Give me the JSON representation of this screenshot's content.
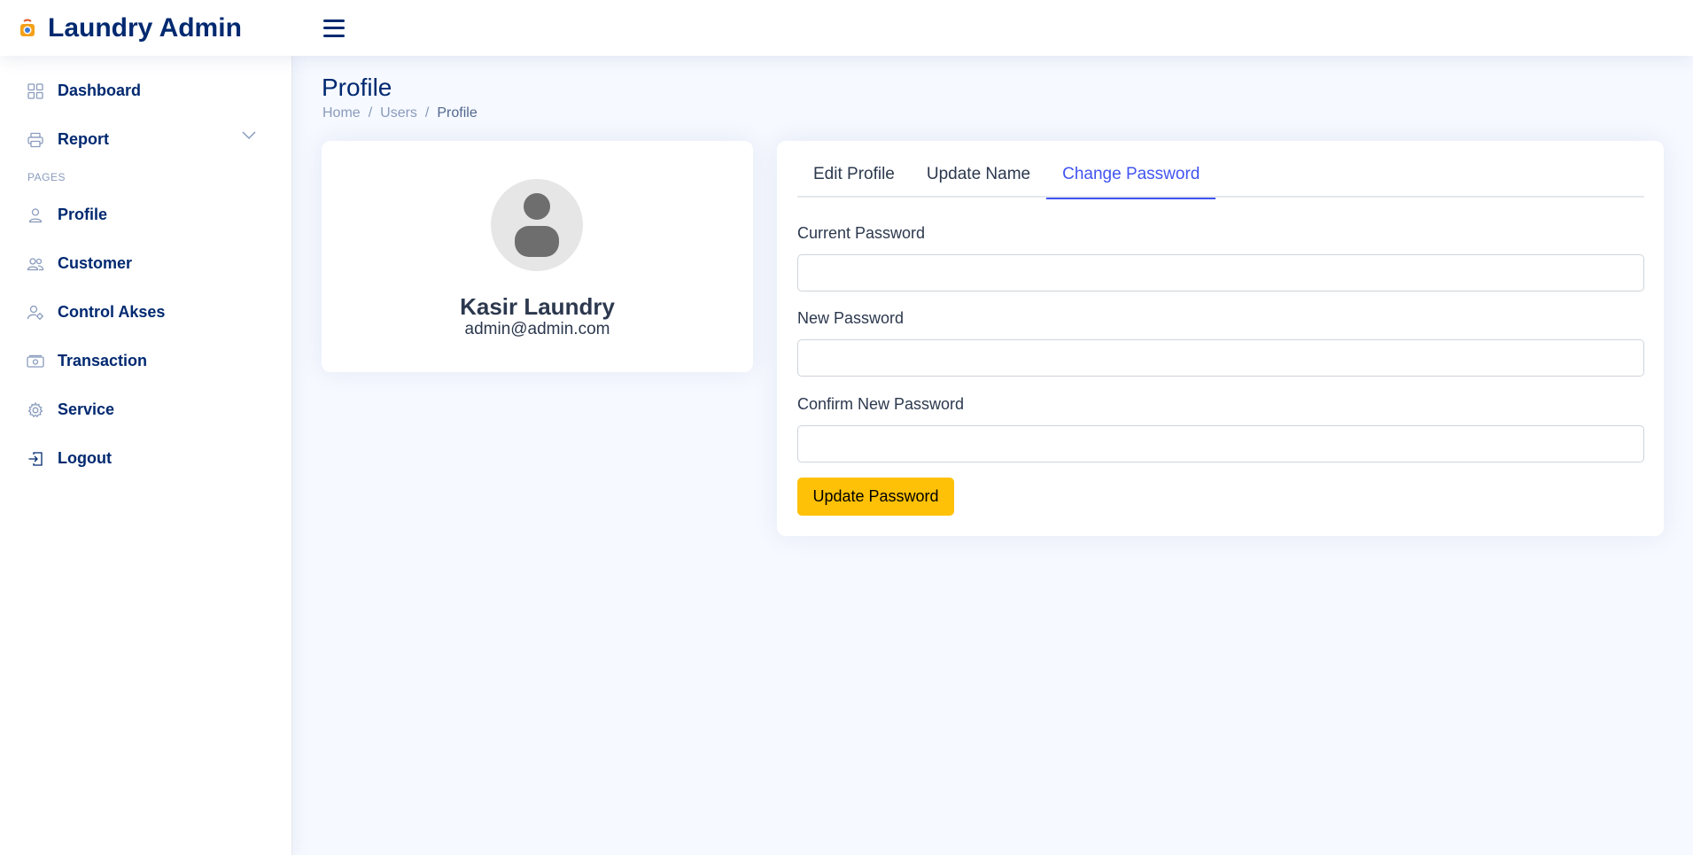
{
  "header": {
    "app_title": "Laundry Admin",
    "logo_icon": "laundry-logo-icon",
    "menu_icon": "hamburger-menu-icon"
  },
  "sidebar": {
    "items": [
      {
        "label": "Dashboard",
        "icon": "grid-icon"
      },
      {
        "label": "Report",
        "icon": "printer-icon",
        "expandable": true
      }
    ],
    "section_heading": "PAGES",
    "pages": [
      {
        "label": "Profile",
        "icon": "person-icon"
      },
      {
        "label": "Customer",
        "icon": "people-icon"
      },
      {
        "label": "Control Akses",
        "icon": "person-gear-icon"
      },
      {
        "label": "Transaction",
        "icon": "cash-icon"
      },
      {
        "label": "Service",
        "icon": "gear-icon"
      },
      {
        "label": "Logout",
        "icon": "box-arrow-in-right-icon"
      }
    ]
  },
  "page": {
    "title": "Profile",
    "breadcrumb": [
      "Home",
      "Users",
      "Profile"
    ]
  },
  "profile": {
    "name": "Kasir Laundry",
    "email": "admin@admin.com"
  },
  "tabs": [
    {
      "label": "Edit Profile",
      "active": false
    },
    {
      "label": "Update Name",
      "active": false
    },
    {
      "label": "Change Password",
      "active": true
    }
  ],
  "form": {
    "current_password_label": "Current Password",
    "current_password_value": "",
    "new_password_label": "New Password",
    "new_password_value": "",
    "confirm_password_label": "Confirm New Password",
    "confirm_password_value": "",
    "submit_label": "Update Password"
  },
  "colors": {
    "primary": "#012970",
    "accent": "#4154f1",
    "button": "#ffc107",
    "background": "#f6f9ff"
  }
}
